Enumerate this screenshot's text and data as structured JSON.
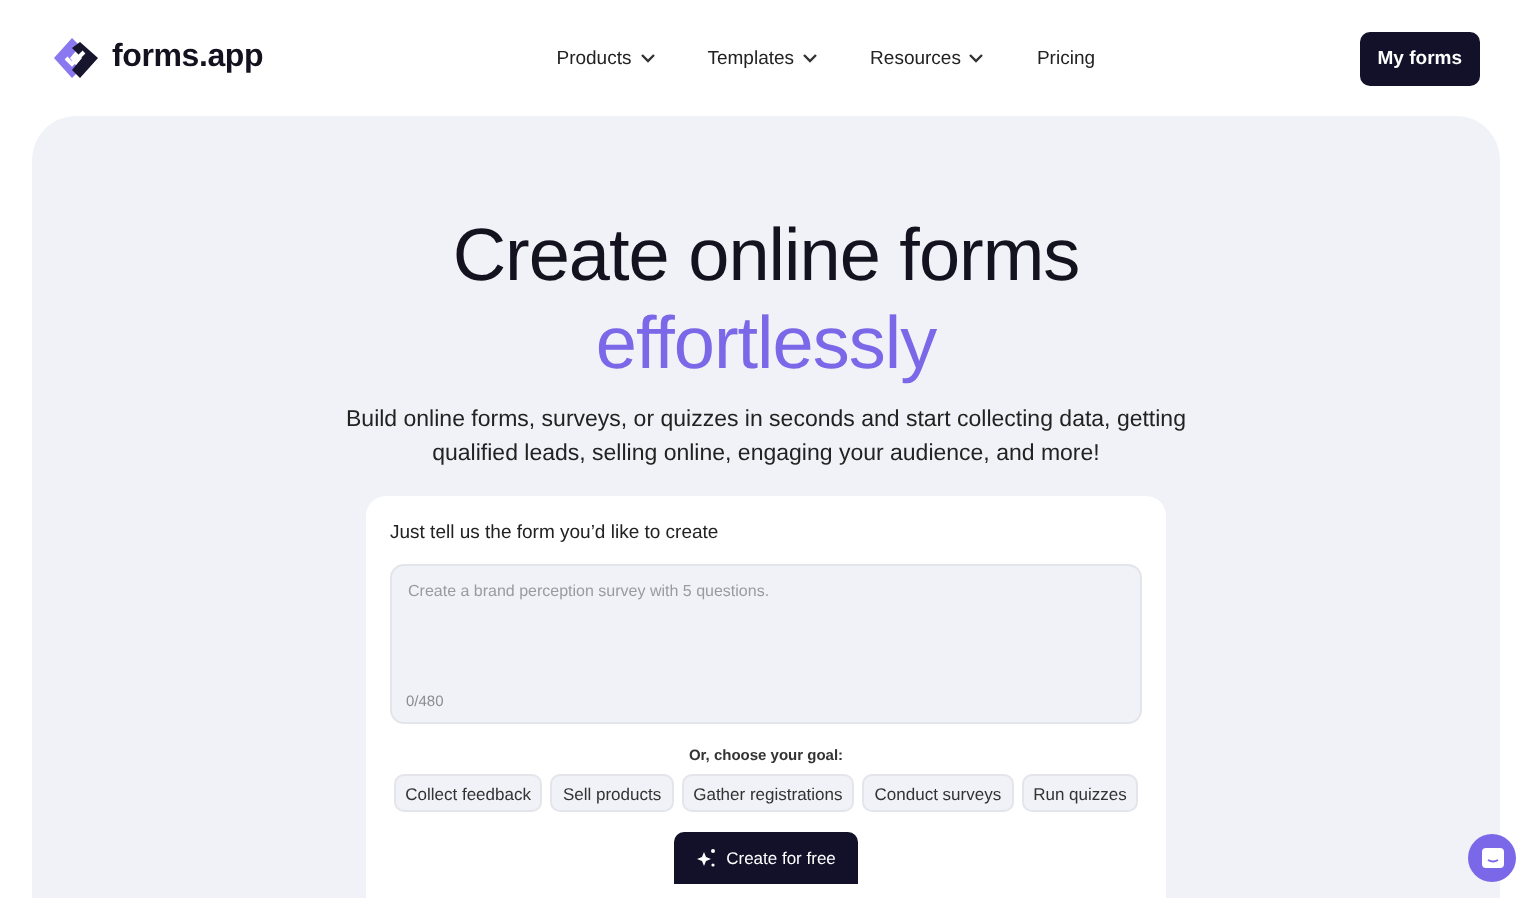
{
  "header": {
    "logo_text": "forms.app",
    "nav": [
      {
        "label": "Products",
        "dropdown": true
      },
      {
        "label": "Templates",
        "dropdown": true
      },
      {
        "label": "Resources",
        "dropdown": true
      },
      {
        "label": "Pricing",
        "dropdown": false
      }
    ],
    "cta": "My forms"
  },
  "hero": {
    "title": "Create online forms",
    "title_accent": "effortlessly",
    "subtitle": "Build online forms, surveys, or quizzes in seconds and start collecting data, getting qualified leads, selling online, engaging your audience, and more!"
  },
  "prompt_card": {
    "label": "Just tell us the form you’d like to create",
    "placeholder": "Create a brand perception survey with 5 questions.",
    "counter": "0/480",
    "goal_label": "Or, choose your goal:",
    "goals": [
      "Collect feedback",
      "Sell products",
      "Gather registrations",
      "Conduct surveys",
      "Run quizzes"
    ],
    "submit": "Create for free"
  }
}
